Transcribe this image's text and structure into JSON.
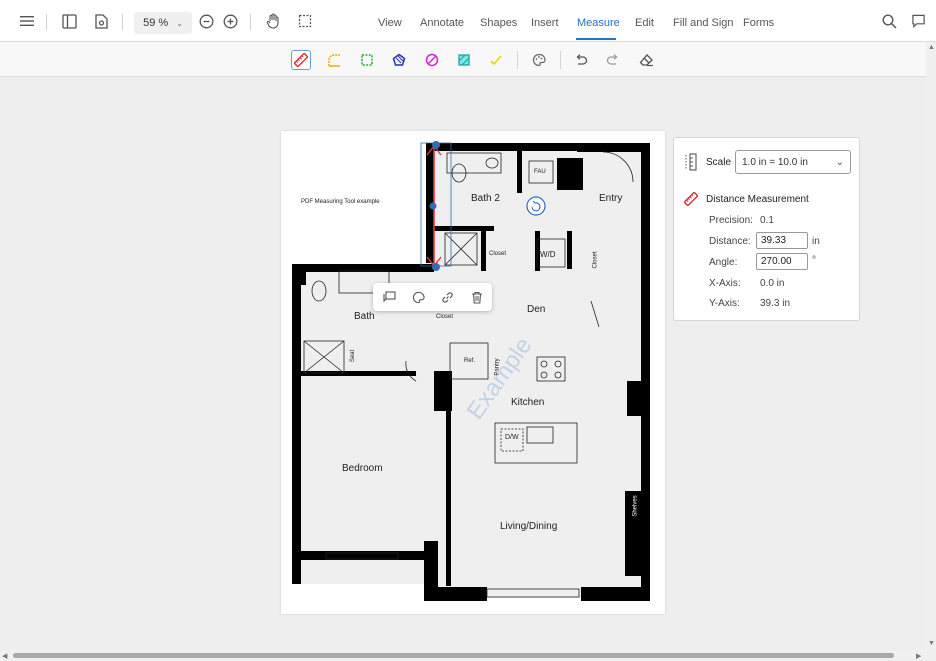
{
  "toolbar": {
    "zoom": "59 %",
    "tabs": [
      {
        "label": "View"
      },
      {
        "label": "Annotate"
      },
      {
        "label": "Shapes"
      },
      {
        "label": "Insert"
      },
      {
        "label": "Measure"
      },
      {
        "label": "Edit"
      },
      {
        "label": "Fill and Sign"
      },
      {
        "label": "Forms"
      }
    ],
    "active_tab": "Measure"
  },
  "measure_tools": [
    "distance-tool",
    "perimeter-tool",
    "area-tool",
    "polygon-area-tool",
    "ellipse-area-tool",
    "rectangle-area-tool",
    "check-tool"
  ],
  "document": {
    "title": "PDF Measuring Tool example",
    "rooms": {
      "bath2": "Bath 2",
      "entry": "Entry",
      "fau": "FAU",
      "closet1": "Closet",
      "wd": "W/D",
      "closet2": "Closet",
      "den": "Den",
      "bath": "Bath",
      "closet3": "Closet",
      "seat": "Seat",
      "ref": "Ref.",
      "pantry": "Pantry",
      "kitchen": "Kitchen",
      "dw": "D/W",
      "bedroom": "Bedroom",
      "living": "Living/Dining",
      "shelves": "Shelves"
    },
    "watermark": "Example"
  },
  "panel": {
    "scale_label": "Scale",
    "scale_value": "1.0 in = 10.0 in",
    "measurement_title": "Distance Measurement",
    "precision_label": "Precision:",
    "precision_value": "0.1",
    "distance_label": "Distance:",
    "distance_value": "39.33",
    "distance_unit": "in",
    "angle_label": "Angle:",
    "angle_value": "270.00",
    "angle_unit": "°",
    "xaxis_label": "X-Axis:",
    "xaxis_value": "0.0 in",
    "yaxis_label": "Y-Axis:",
    "yaxis_value": "39.3 in"
  },
  "colors": {
    "accent": "#2a6fc9",
    "measure_line": "#e53935",
    "handle": "#2f6db5"
  }
}
